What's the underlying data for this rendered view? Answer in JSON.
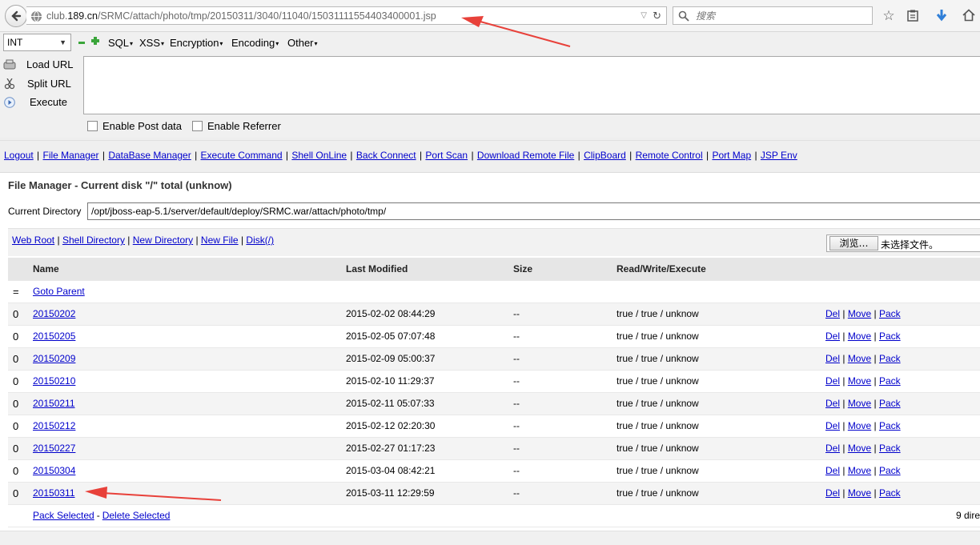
{
  "browser": {
    "url_host_prefix": "club.",
    "url_host_bold": "189.cn",
    "url_path": "/SRMC/attach/photo/tmp/20150311/3040/11040/15031111554403400001.jsp",
    "search_placeholder": "搜索"
  },
  "hackbar": {
    "select_value": "INT",
    "menus": [
      "SQL",
      "XSS",
      "Encryption",
      "Encoding",
      "Other"
    ],
    "load_url": "Load URL",
    "split_url": "Split URL",
    "execute": "Execute",
    "enable_post": "Enable Post data",
    "enable_referrer": "Enable Referrer"
  },
  "nav": {
    "links": [
      "Logout",
      "File Manager",
      "DataBase Manager",
      "Execute Command",
      "Shell OnLine",
      "Back Connect",
      "Port Scan",
      "Download Remote File",
      "ClipBoard",
      "Remote Control",
      "Port Map",
      "JSP Env"
    ]
  },
  "file_manager": {
    "title": "File Manager - Current disk \"/\" total (unknow)",
    "current_dir_label": "Current Directory",
    "current_dir_value": "/opt/jboss-eap-5.1/server/default/deploy/SRMC.war/attach/photo/tmp/",
    "actions": [
      "Web Root",
      "Shell Directory",
      "New Directory",
      "New File",
      "Disk(/)"
    ],
    "browse_button": "浏览…",
    "no_file_selected": "未选择文件。",
    "columns": {
      "name": "Name",
      "modified": "Last Modified",
      "size": "Size",
      "rwx": "Read/Write/Execute"
    },
    "parent": {
      "marker": "=",
      "label": "Goto Parent"
    },
    "rows": [
      {
        "mark": "0",
        "name": "20150202",
        "modified": "2015-02-02 08:44:29",
        "size": "--",
        "rwx": "true / true / unknow"
      },
      {
        "mark": "0",
        "name": "20150205",
        "modified": "2015-02-05 07:07:48",
        "size": "--",
        "rwx": "true / true / unknow"
      },
      {
        "mark": "0",
        "name": "20150209",
        "modified": "2015-02-09 05:00:37",
        "size": "--",
        "rwx": "true / true / unknow"
      },
      {
        "mark": "0",
        "name": "20150210",
        "modified": "2015-02-10 11:29:37",
        "size": "--",
        "rwx": "true / true / unknow"
      },
      {
        "mark": "0",
        "name": "20150211",
        "modified": "2015-02-11 05:07:33",
        "size": "--",
        "rwx": "true / true / unknow"
      },
      {
        "mark": "0",
        "name": "20150212",
        "modified": "2015-02-12 02:20:30",
        "size": "--",
        "rwx": "true / true / unknow"
      },
      {
        "mark": "0",
        "name": "20150227",
        "modified": "2015-02-27 01:17:23",
        "size": "--",
        "rwx": "true / true / unknow"
      },
      {
        "mark": "0",
        "name": "20150304",
        "modified": "2015-03-04 08:42:21",
        "size": "--",
        "rwx": "true / true / unknow"
      },
      {
        "mark": "0",
        "name": "20150311",
        "modified": "2015-03-11 12:29:59",
        "size": "--",
        "rwx": "true / true / unknow"
      }
    ],
    "row_actions": [
      "Del",
      "Move",
      "Pack"
    ],
    "footer": {
      "pack_selected": "Pack Selected",
      "dash": "-",
      "delete_selected": "Delete Selected",
      "right_text": "9 dire"
    }
  },
  "colors": {
    "annotation_arrow": "#e8413a",
    "link": "#0000cc",
    "hackbar_bg": "#f0f0f0"
  }
}
